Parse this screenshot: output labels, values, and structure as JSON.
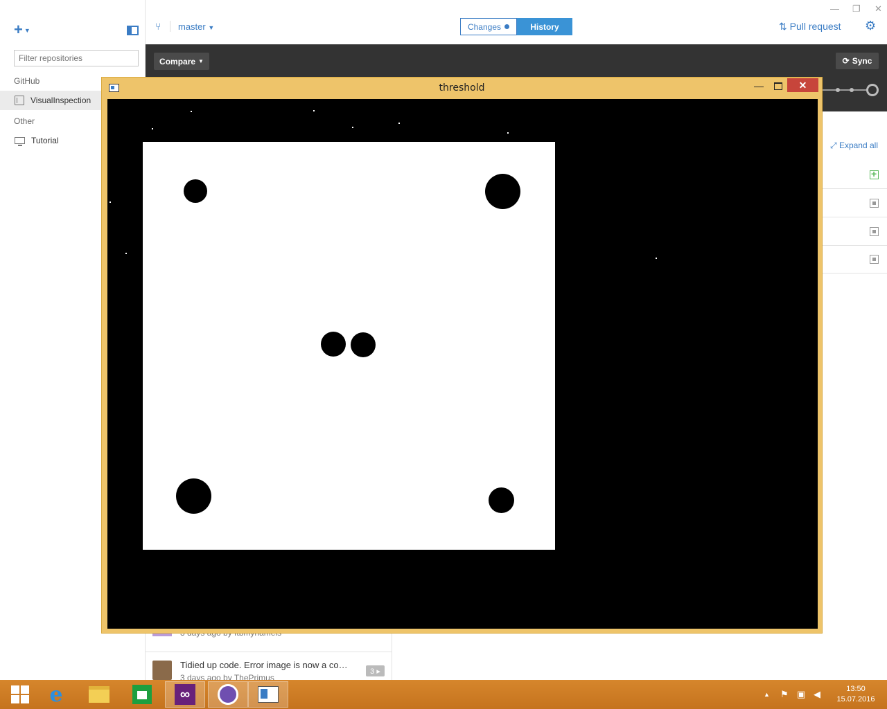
{
  "sidebar": {
    "add_icon": "plus-icon",
    "filter_placeholder": "Filter repositories",
    "groups": [
      {
        "label": "GitHub",
        "repos": [
          {
            "name": "VisualInspection",
            "icon": "book-icon",
            "active": true
          }
        ]
      },
      {
        "label": "Other",
        "repos": [
          {
            "name": "Tutorial",
            "icon": "monitor-icon",
            "active": false
          }
        ]
      }
    ]
  },
  "topbar": {
    "branch": "master",
    "tabs": {
      "changes": "Changes",
      "history": "History"
    },
    "pull_request": "Pull request",
    "settings_icon": "gear-icon"
  },
  "toolbar": {
    "compare_label": "Compare",
    "sync_label": "Sync"
  },
  "changes_panel": {
    "expand_all": "Expand all",
    "file_statuses": [
      "added",
      "modified",
      "modified",
      "modified"
    ]
  },
  "history": {
    "commits": [
      {
        "title": "",
        "meta": "3 days ago by ftbmynameis",
        "badge": ""
      },
      {
        "title": "Tidied up code. Error image is now a co…",
        "meta": "3 days ago by ThePrimus",
        "badge": "3 ▸"
      }
    ]
  },
  "cv_window": {
    "title": "threshold"
  },
  "taskbar": {
    "apps": [
      "start",
      "internet-explorer",
      "file-explorer",
      "store",
      "visual-studio",
      "github-desktop",
      "threshold-app"
    ],
    "time": "13:50",
    "date": "15.07.2016"
  },
  "colors": {
    "accent": "#3a7cc4",
    "history_tab": "#3a93d6",
    "dark_toolbar": "#333333",
    "cv_frame": "#eec46a",
    "close_red": "#c7453b",
    "taskbar": "#c5731e"
  }
}
